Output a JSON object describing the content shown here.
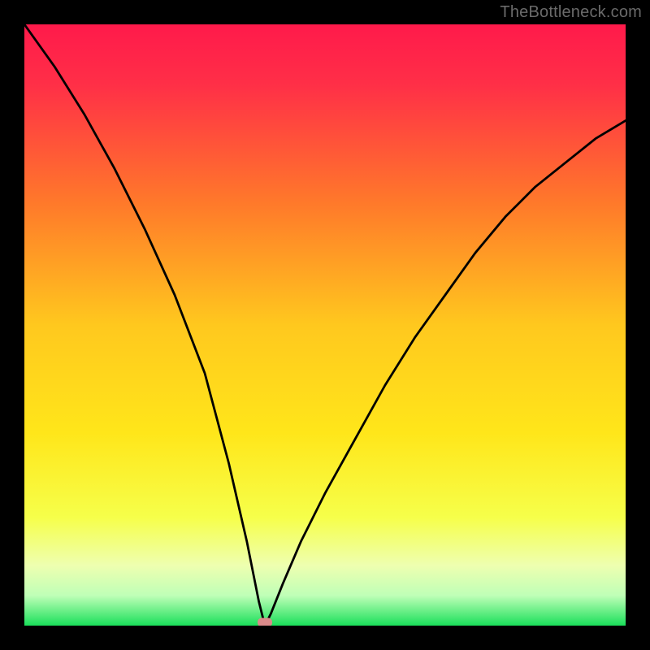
{
  "watermark": "TheBottleneck.com",
  "colors": {
    "bg_frame": "#000000",
    "gradient_top": "#ff1a4b",
    "gradient_mid_upper": "#ff9a1e",
    "gradient_mid": "#ffe61a",
    "gradient_lower": "#f8ff66",
    "gradient_bottom": "#1adf5a",
    "curve": "#000000",
    "marker": "#db8a8a"
  },
  "chart_data": {
    "type": "line",
    "title": "",
    "xlabel": "",
    "ylabel": "",
    "xlim": [
      0,
      100
    ],
    "ylim": [
      0,
      100
    ],
    "marker": {
      "x": 40,
      "y": 0
    },
    "series": [
      {
        "name": "bottleneck-curve",
        "x": [
          0,
          5,
          10,
          15,
          20,
          25,
          30,
          34,
          37,
          39,
          40,
          41,
          43,
          46,
          50,
          55,
          60,
          65,
          70,
          75,
          80,
          85,
          90,
          95,
          100
        ],
        "values": [
          100,
          93,
          85,
          76,
          66,
          55,
          42,
          27,
          14,
          4,
          0,
          2,
          7,
          14,
          22,
          31,
          40,
          48,
          55,
          62,
          68,
          73,
          77,
          81,
          84
        ]
      }
    ]
  }
}
